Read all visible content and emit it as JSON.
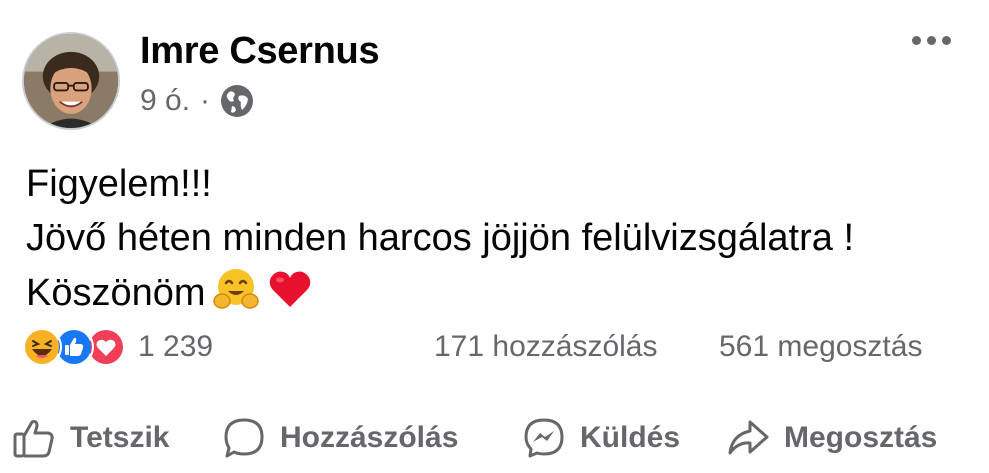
{
  "post": {
    "author": "Imre Csernus",
    "time": "9 ó.",
    "separator": "·",
    "privacy_icon": "globe-icon",
    "text_lines": [
      "Figyelem!!!",
      "Jövő héten minden harcos jöjjön felülvizsgálatra !",
      "Köszönöm"
    ],
    "text_emojis": [
      "hugging-face-emoji",
      "red-heart-emoji"
    ]
  },
  "stats": {
    "reaction_icons": [
      "haha-icon",
      "like-icon",
      "love-icon"
    ],
    "reaction_count": "1 239",
    "comments": "171 hozzászólás",
    "shares": "561 megosztás"
  },
  "actions": {
    "like": "Tetszik",
    "comment": "Hozzászólás",
    "send": "Küldés",
    "share": "Megosztás"
  },
  "colors": {
    "text": "#050505",
    "secondary": "#65676b",
    "like_blue": "#1877f2",
    "love_red": "#f33e58",
    "haha_yellow": "#f7b125"
  }
}
